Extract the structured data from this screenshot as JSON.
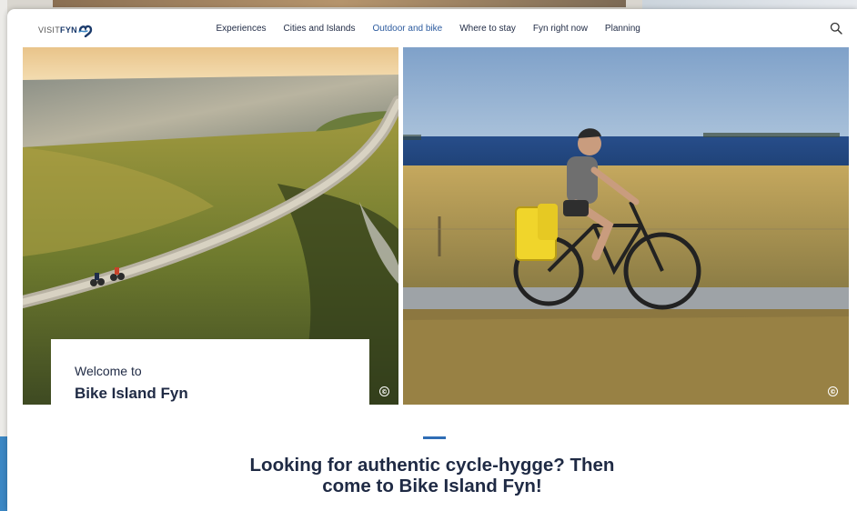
{
  "logo": {
    "visit": "VISIT",
    "fyn": "FYN"
  },
  "nav": {
    "items": [
      {
        "label": "Experiences"
      },
      {
        "label": "Cities and Islands"
      },
      {
        "label": "Outdoor and bike"
      },
      {
        "label": "Where to stay"
      },
      {
        "label": "Fyn right now"
      },
      {
        "label": "Planning"
      }
    ],
    "active": "Outdoor and bike"
  },
  "hero": {
    "welcome_small": "Welcome to",
    "welcome_big": "Bike Island Fyn",
    "copyright_symbol": "©"
  },
  "intro": {
    "headline_line1": "Looking for authentic cycle-hygge? Then",
    "headline_line2": "come to Bike Island Fyn!"
  },
  "colors": {
    "brand_navy": "#1b3a6b",
    "text_dark": "#1f2a44",
    "accent_blue": "#2f6db5",
    "nav_active": "#2b5a9e"
  },
  "icons": {
    "logo": "heart-wave-logo-icon",
    "search": "search-icon",
    "copyright": "copyright-icon"
  }
}
